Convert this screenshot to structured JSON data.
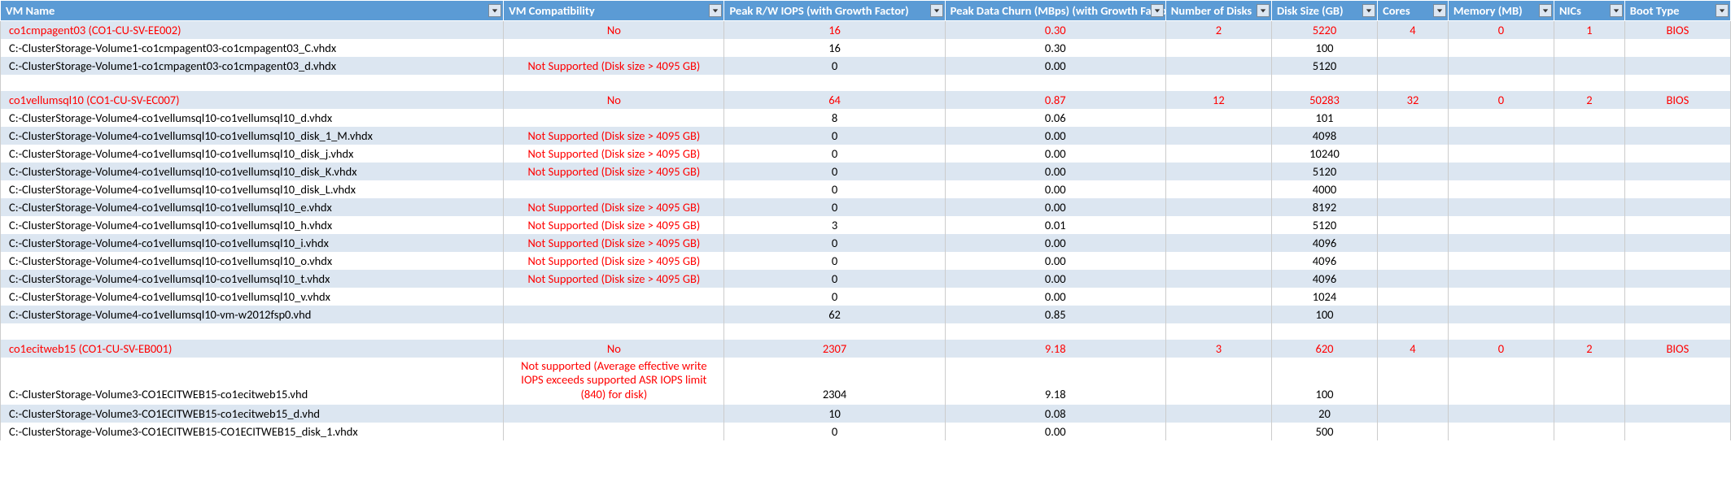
{
  "headers": {
    "vm_name": "VM Name",
    "vm_compat": "VM Compatibility",
    "peak_iops": "Peak R/W IOPS (with Growth Factor)",
    "peak_churn": "Peak Data Churn (MBps) (with Growth Factor)",
    "num_disks": "Number of Disks",
    "disk_size": "Disk Size (GB)",
    "cores": "Cores",
    "memory": "Memory (MB)",
    "nics": "NICs",
    "boot": "Boot Type"
  },
  "rows": [
    {
      "type": "vm",
      "alt": true,
      "red": true,
      "name": "co1cmpagent03 (CO1-CU-SV-EE002)",
      "compat": "No",
      "iops": "16",
      "churn": "0.30",
      "ndisk": "2",
      "dsize": "5220",
      "cores": "4",
      "mem": "0",
      "nics": "1",
      "boot": "BIOS"
    },
    {
      "type": "disk",
      "alt": false,
      "name": "C:-ClusterStorage-Volume1-co1cmpagent03-co1cmpagent03_C.vhdx",
      "compat": "",
      "iops": "16",
      "churn": "0.30",
      "dsize": "100"
    },
    {
      "type": "disk",
      "alt": true,
      "compat_red": true,
      "name": "C:-ClusterStorage-Volume1-co1cmpagent03-co1cmpagent03_d.vhdx",
      "compat": "Not Supported (Disk size > 4095 GB)",
      "iops": "0",
      "churn": "0.00",
      "dsize": "5120"
    },
    {
      "type": "blank",
      "alt": false
    },
    {
      "type": "vm",
      "alt": true,
      "red": true,
      "name": "co1vellumsql10 (CO1-CU-SV-EC007)",
      "compat": "No",
      "iops": "64",
      "churn": "0.87",
      "ndisk": "12",
      "dsize": "50283",
      "cores": "32",
      "mem": "0",
      "nics": "2",
      "boot": "BIOS"
    },
    {
      "type": "disk",
      "alt": false,
      "name": "C:-ClusterStorage-Volume4-co1vellumsql10-co1vellumsql10_d.vhdx",
      "compat": "",
      "iops": "8",
      "churn": "0.06",
      "dsize": "101"
    },
    {
      "type": "disk",
      "alt": true,
      "compat_red": true,
      "name": "C:-ClusterStorage-Volume4-co1vellumsql10-co1vellumsql10_disk_1_M.vhdx",
      "compat": "Not Supported (Disk size > 4095 GB)",
      "iops": "0",
      "churn": "0.00",
      "dsize": "4098"
    },
    {
      "type": "disk",
      "alt": false,
      "compat_red": true,
      "name": "C:-ClusterStorage-Volume4-co1vellumsql10-co1vellumsql10_disk_j.vhdx",
      "compat": "Not Supported (Disk size > 4095 GB)",
      "iops": "0",
      "churn": "0.00",
      "dsize": "10240"
    },
    {
      "type": "disk",
      "alt": true,
      "compat_red": true,
      "name": "C:-ClusterStorage-Volume4-co1vellumsql10-co1vellumsql10_disk_K.vhdx",
      "compat": "Not Supported (Disk size > 4095 GB)",
      "iops": "0",
      "churn": "0.00",
      "dsize": "5120"
    },
    {
      "type": "disk",
      "alt": false,
      "name": "C:-ClusterStorage-Volume4-co1vellumsql10-co1vellumsql10_disk_L.vhdx",
      "compat": "",
      "iops": "0",
      "churn": "0.00",
      "dsize": "4000"
    },
    {
      "type": "disk",
      "alt": true,
      "compat_red": true,
      "name": "C:-ClusterStorage-Volume4-co1vellumsql10-co1vellumsql10_e.vhdx",
      "compat": "Not Supported (Disk size > 4095 GB)",
      "iops": "0",
      "churn": "0.00",
      "dsize": "8192"
    },
    {
      "type": "disk",
      "alt": false,
      "compat_red": true,
      "name": "C:-ClusterStorage-Volume4-co1vellumsql10-co1vellumsql10_h.vhdx",
      "compat": "Not Supported (Disk size > 4095 GB)",
      "iops": "3",
      "churn": "0.01",
      "dsize": "5120"
    },
    {
      "type": "disk",
      "alt": true,
      "compat_red": true,
      "name": "C:-ClusterStorage-Volume4-co1vellumsql10-co1vellumsql10_i.vhdx",
      "compat": "Not Supported (Disk size > 4095 GB)",
      "iops": "0",
      "churn": "0.00",
      "dsize": "4096"
    },
    {
      "type": "disk",
      "alt": false,
      "compat_red": true,
      "name": "C:-ClusterStorage-Volume4-co1vellumsql10-co1vellumsql10_o.vhdx",
      "compat": "Not Supported (Disk size > 4095 GB)",
      "iops": "0",
      "churn": "0.00",
      "dsize": "4096"
    },
    {
      "type": "disk",
      "alt": true,
      "compat_red": true,
      "name": "C:-ClusterStorage-Volume4-co1vellumsql10-co1vellumsql10_t.vhdx",
      "compat": "Not Supported (Disk size > 4095 GB)",
      "iops": "0",
      "churn": "0.00",
      "dsize": "4096"
    },
    {
      "type": "disk",
      "alt": false,
      "name": "C:-ClusterStorage-Volume4-co1vellumsql10-co1vellumsql10_v.vhdx",
      "compat": "",
      "iops": "0",
      "churn": "0.00",
      "dsize": "1024"
    },
    {
      "type": "disk",
      "alt": true,
      "name": "C:-ClusterStorage-Volume4-co1vellumsql10-vm-w2012fsp0.vhd",
      "compat": "",
      "iops": "62",
      "churn": "0.85",
      "dsize": "100"
    },
    {
      "type": "blank",
      "alt": false
    },
    {
      "type": "vm",
      "alt": true,
      "red": true,
      "name": "co1ecitweb15 (CO1-CU-SV-EB001)",
      "compat": "No",
      "iops": "2307",
      "churn": "9.18",
      "ndisk": "3",
      "dsize": "620",
      "cores": "4",
      "mem": "0",
      "nics": "2",
      "boot": "BIOS"
    },
    {
      "type": "disk",
      "alt": false,
      "compat_red": true,
      "multiline": true,
      "name": "C:-ClusterStorage-Volume3-CO1ECITWEB15-co1ecitweb15.vhd",
      "compat": "Not supported  (Average effective write IOPS exceeds supported ASR IOPS limit (840) for disk)",
      "iops": "2304",
      "churn": "9.18",
      "dsize": "100"
    },
    {
      "type": "disk",
      "alt": true,
      "name": "C:-ClusterStorage-Volume3-CO1ECITWEB15-co1ecitweb15_d.vhd",
      "compat": "",
      "iops": "10",
      "churn": "0.08",
      "dsize": "20"
    },
    {
      "type": "disk",
      "alt": false,
      "name": "C:-ClusterStorage-Volume3-CO1ECITWEB15-CO1ECITWEB15_disk_1.vhdx",
      "compat": "",
      "iops": "0",
      "churn": "0.00",
      "dsize": "500"
    }
  ]
}
